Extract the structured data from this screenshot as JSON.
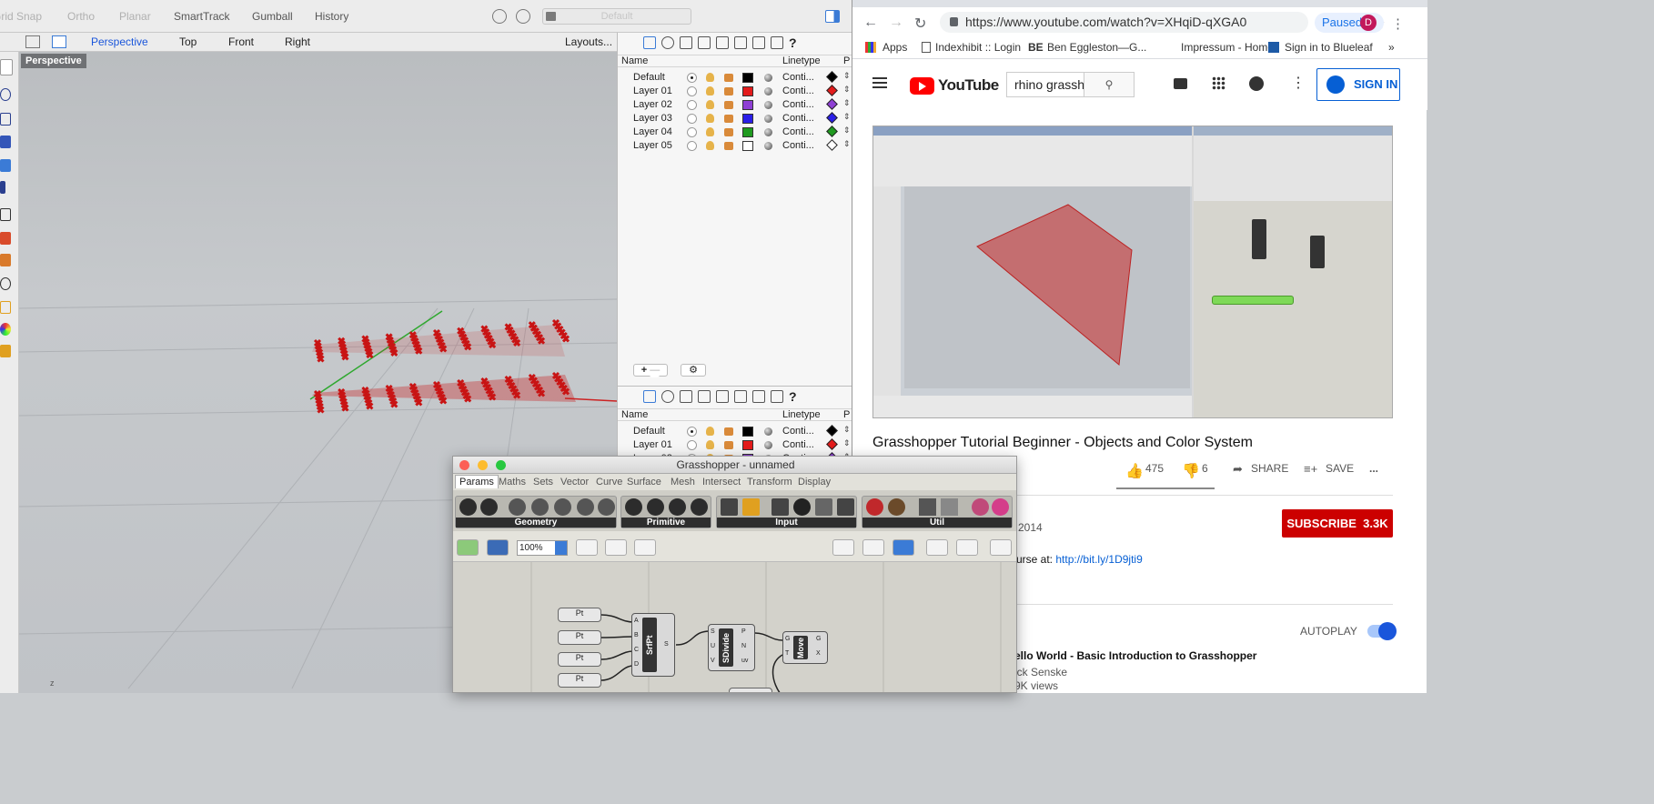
{
  "rhino": {
    "statusbar": [
      "Grid Snap",
      "Ortho",
      "Planar",
      "SmartTrack",
      "Gumball",
      "History"
    ],
    "statusbar_active": [
      false,
      false,
      false,
      true,
      true,
      true
    ],
    "layer_search_placeholder": "Default",
    "view_tabs": [
      "Perspective",
      "Top",
      "Front",
      "Right"
    ],
    "layouts_label": "Layouts...",
    "viewport_title": "Perspective",
    "viewport_axis": "z"
  },
  "layers": {
    "col_name": "Name",
    "col_linetype": "Linetype",
    "col_print": "P",
    "rows": [
      {
        "name": "Default",
        "color": "#000000",
        "current": true,
        "linetype": "Conti..."
      },
      {
        "name": "Layer 01",
        "color": "#e31b1b",
        "current": false,
        "linetype": "Conti..."
      },
      {
        "name": "Layer 02",
        "color": "#8e3fd4",
        "current": false,
        "linetype": "Conti..."
      },
      {
        "name": "Layer 03",
        "color": "#2a1ee8",
        "current": false,
        "linetype": "Conti..."
      },
      {
        "name": "Layer 04",
        "color": "#1f9a1f",
        "current": false,
        "linetype": "Conti..."
      },
      {
        "name": "Layer 05",
        "color": "#ffffff",
        "current": false,
        "linetype": "Conti..."
      }
    ],
    "add_label": "+",
    "remove_label": "—",
    "gear_label": "⚙"
  },
  "chrome": {
    "url": "https://www.youtube.com/watch?v=XHqiD-qXGA0",
    "paused_label": "Paused",
    "avatar_letter": "D",
    "bookmarks": [
      "Apps",
      "Indexhibit :: Login",
      "Ben Eggleston—G...",
      "Impressum - Home",
      "Sign in to Blueleaf"
    ],
    "bookmark_more": "»"
  },
  "youtube": {
    "logo_text": "YouTube",
    "search_value": "rhino grassh",
    "signin_label": "SIGN IN",
    "video_title": "Grasshopper Tutorial Beginner - Objects and Color System",
    "likes": "475",
    "dislikes": "6",
    "share_label": "SHARE",
    "save_label": "SAVE",
    "more_label": "...",
    "date_fragment": "2014",
    "subscribe_label": "SUBSCRIBE",
    "subscribe_count": "3.3K",
    "desc_fragment": "urse at:",
    "desc_link": "http://bit.ly/1D9jti9",
    "autoplay_label": "AUTOPLAY",
    "next_title": "ello World - Basic Introduction to Grasshopper",
    "next_channel": "ick Senske",
    "next_views": "9K views"
  },
  "grasshopper": {
    "window_title": "Grasshopper - unnamed",
    "tabs": [
      "Params",
      "Maths",
      "Sets",
      "Vector",
      "Curve",
      "Surface",
      "Mesh",
      "Intersect",
      "Transform",
      "Display"
    ],
    "active_tab": "Params",
    "categories": [
      "Geometry",
      "Primitive",
      "Input",
      "Util"
    ],
    "zoom": "100%",
    "nodes": {
      "pt_label": "Pt",
      "srfpt_label": "SrfPt",
      "sdivide_label": "SDivide",
      "move_label": "Move",
      "srfpt_inputs": [
        "A",
        "B",
        "C",
        "D"
      ],
      "srfpt_output": "S",
      "sdivide_inputs": [
        "S",
        "U",
        "V"
      ],
      "sdivide_outputs": [
        "P",
        "N",
        "uv"
      ],
      "move_inputs": [
        "G",
        "T"
      ],
      "move_outputs": [
        "G",
        "X"
      ]
    }
  }
}
